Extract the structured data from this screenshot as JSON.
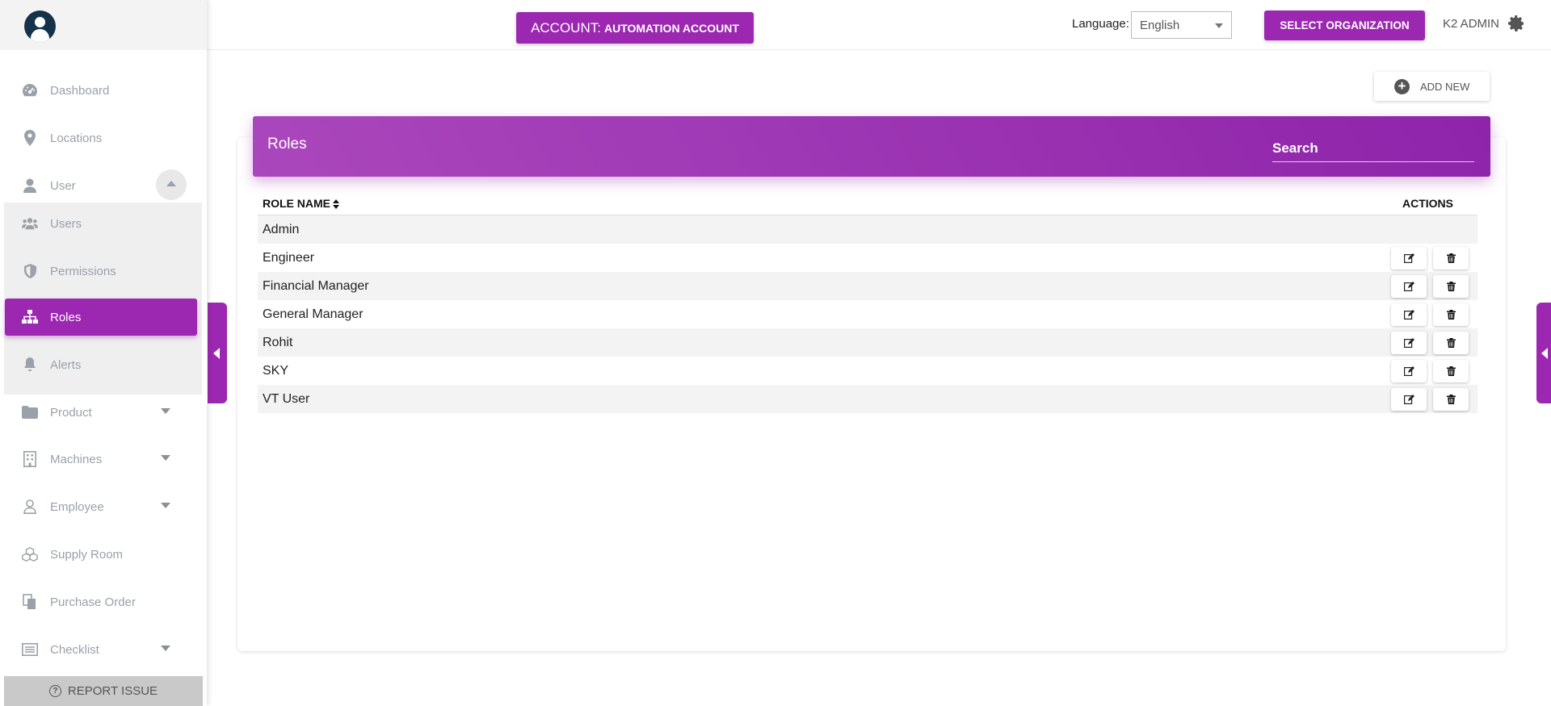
{
  "sidebar": {
    "items": [
      {
        "label": "Dashboard",
        "icon": "dashboard-icon"
      },
      {
        "label": "Locations",
        "icon": "location-pin-icon"
      },
      {
        "label": "User",
        "icon": "user-icon"
      },
      {
        "label": "Users",
        "icon": "users-icon"
      },
      {
        "label": "Permissions",
        "icon": "shield-icon"
      },
      {
        "label": "Roles",
        "icon": "sitemap-icon"
      },
      {
        "label": "Alerts",
        "icon": "bell-icon"
      },
      {
        "label": "Product",
        "icon": "folder-icon"
      },
      {
        "label": "Machines",
        "icon": "building-icon"
      },
      {
        "label": "Employee",
        "icon": "person-outline-icon"
      },
      {
        "label": "Supply Room",
        "icon": "cubes-icon"
      },
      {
        "label": "Purchase Order",
        "icon": "documents-icon"
      },
      {
        "label": "Checklist",
        "icon": "checklist-icon"
      }
    ],
    "active": "Roles",
    "report_issue": "REPORT ISSUE"
  },
  "header": {
    "account_prefix": "ACCOUNT:",
    "account_name": "AUTOMATION ACCOUNT",
    "language_label": "Language:",
    "language_value": "English",
    "select_org": "SELECT ORGANIZATION",
    "user_name": "K2 ADMIN"
  },
  "main": {
    "add_new": "ADD NEW",
    "card_title": "Roles",
    "search_placeholder": "Search",
    "columns": [
      "ROLE NAME",
      "ACTIONS"
    ],
    "rows": [
      {
        "name": "Admin",
        "actions": false
      },
      {
        "name": "Engineer",
        "actions": true
      },
      {
        "name": "Financial Manager",
        "actions": true
      },
      {
        "name": "General Manager",
        "actions": true
      },
      {
        "name": "Rohit",
        "actions": true
      },
      {
        "name": "SKY",
        "actions": true
      },
      {
        "name": "VT User",
        "actions": true
      }
    ]
  },
  "colors": {
    "accent": "#9c27b0",
    "sidebar_text": "#9aa1a9"
  }
}
